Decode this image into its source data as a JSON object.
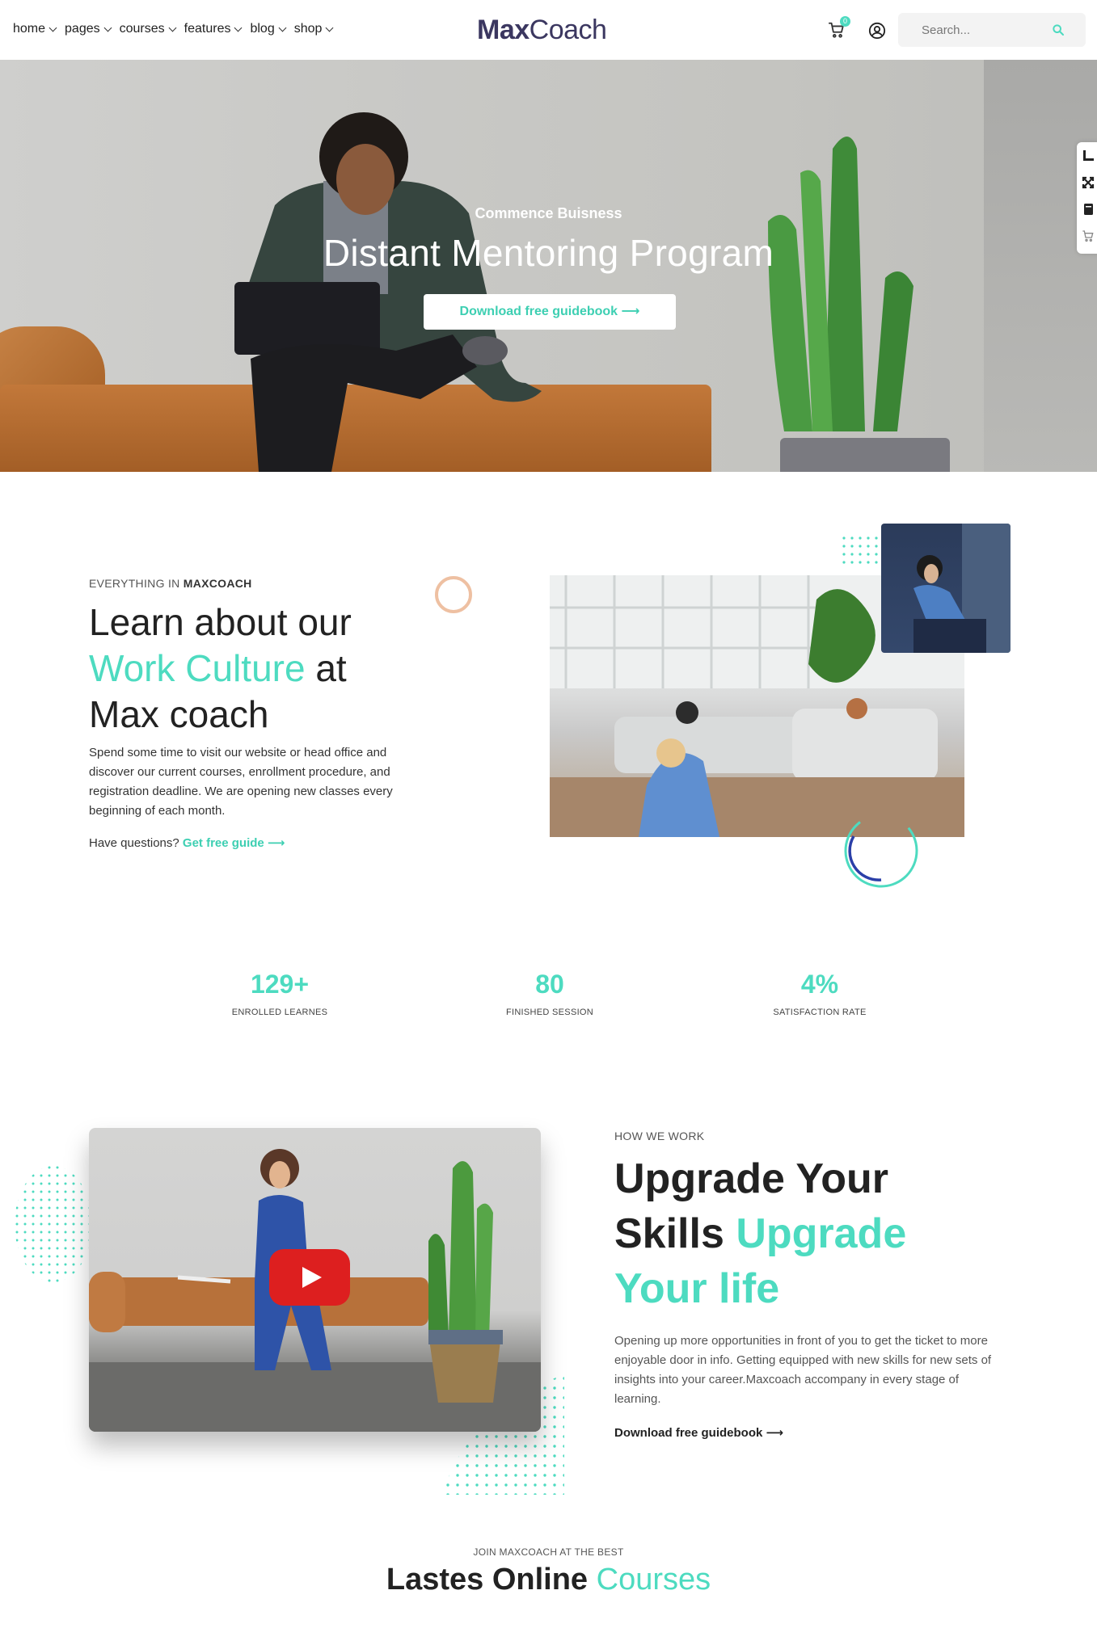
{
  "colors": {
    "accent": "#4ddbc0",
    "peach": "#eec0a2",
    "brand": "#3b3760",
    "youtube": "#dd1f1f"
  },
  "nav": [
    {
      "label": "home"
    },
    {
      "label": "pages"
    },
    {
      "label": "courses"
    },
    {
      "label": "features"
    },
    {
      "label": "blog"
    },
    {
      "label": "shop"
    }
  ],
  "logo": {
    "bold": "Max",
    "regular": "Coach"
  },
  "cart": {
    "count": "0",
    "icon": "cart-icon"
  },
  "user_icon": "user-circle-icon",
  "search": {
    "placeholder": "Search...",
    "icon": "search-icon"
  },
  "side_tools": [
    "ruler-icon",
    "fullscreen-icon",
    "book-icon",
    "cart-icon"
  ],
  "hero": {
    "subtitle": "Commence Buisness",
    "title": "Distant Mentoring Program",
    "button": "Download free guidebook ⟶"
  },
  "about": {
    "eyebrow_prefix": "EVERYTHING IN ",
    "eyebrow_bold": "MAXCOACH",
    "title_line1": "Learn about our",
    "title_accent": "Work Culture",
    "title_after": " at",
    "title_line3": "Max coach",
    "text": "Spend some time to visit our website or head office and discover our current courses, enrollment procedure, and registration deadline. We are opening new classes every beginning of each month.",
    "question": "Have questions? ",
    "link": "Get free guide ⟶"
  },
  "stats": [
    {
      "value": "129+",
      "label": "ENROLLED LEARNES"
    },
    {
      "value": "80",
      "label": "FINISHED SESSION"
    },
    {
      "value": "4%",
      "label": "SATISFACTION RATE"
    }
  ],
  "how": {
    "eyebrow": "HOW WE WORK",
    "title_line1": "Upgrade Your",
    "title_line2": "Skills ",
    "title_accent1": "Upgrade",
    "title_accent2": "Your life",
    "text": "Opening up more opportunities in front of you to get the ticket to more enjoyable door in info. Getting equipped with new skills for new sets of insights into your career.Maxcoach accompany in every stage of learning.",
    "link": "Download free guidebook ⟶"
  },
  "video": {
    "play_icon": "youtube-play-icon"
  },
  "courses": {
    "eyebrow": "JOIN MAXCOACH AT THE BEST",
    "title": "Lastes Online ",
    "title_accent": "Courses"
  }
}
